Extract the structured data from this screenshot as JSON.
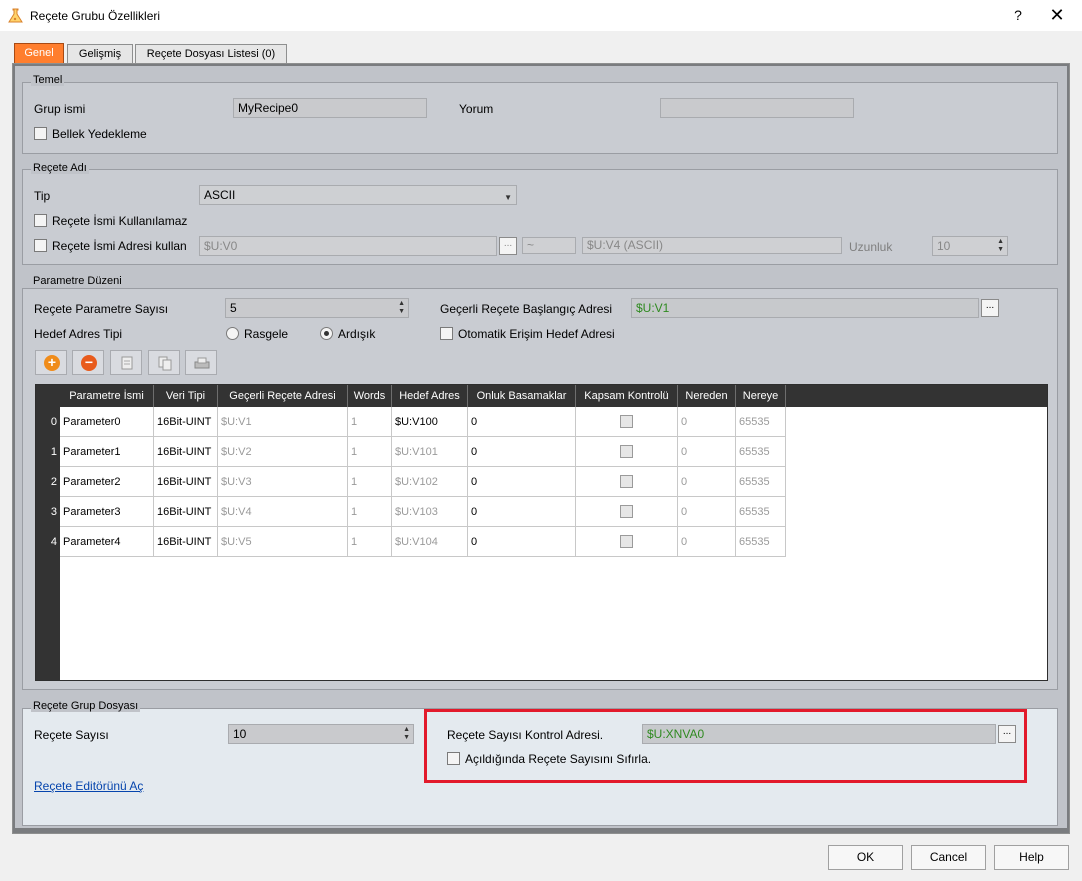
{
  "window": {
    "title": "Reçete Grubu Özellikleri",
    "help_glyph": "?",
    "close_glyph": "✕"
  },
  "tabs": [
    {
      "label": "Genel",
      "active": true
    },
    {
      "label": "Gelişmiş",
      "active": false
    },
    {
      "label": "Reçete Dosyası Listesi (0)",
      "active": false
    }
  ],
  "temel": {
    "title": "Temel",
    "grup_ismi_label": "Grup ismi",
    "grup_ismi_value": "MyRecipe0",
    "yorum_label": "Yorum",
    "yorum_value": "",
    "bellek_label": "Bellek Yedekleme",
    "bellek_checked": false
  },
  "recete_adi": {
    "title": "Reçete Adı",
    "tip_label": "Tip",
    "tip_value": "ASCII",
    "kullanilamaz_label": "Reçete İsmi Kullanılamaz",
    "adresi_label": "Reçete İsmi Adresi kullan",
    "adres_from": "$U:V0",
    "dots": "...",
    "tilde": "~",
    "adres_to": "$U:V4 (ASCII)",
    "uzunluk_label": "Uzunluk",
    "uzunluk_value": "10"
  },
  "parametre": {
    "title": "Parametre Düzeni",
    "sayisi_label": "Reçete Parametre Sayısı",
    "sayisi_value": "5",
    "baslangic_label": "Geçerli Reçete Başlangıç Adresi",
    "baslangic_value": "$U:V1",
    "dots": "...",
    "hedef_tipi_label": "Hedef Adres Tipi",
    "rasgele_label": "Rasgele",
    "ardisik_label": "Ardışık",
    "selected": "Ardışık",
    "otomatik_label": "Otomatik Erişim Hedef Adresi",
    "toolbar": {
      "add": "+",
      "remove": "−"
    }
  },
  "grid": {
    "columns": [
      "Parametre İsmi",
      "Veri Tipi",
      "Geçerli Reçete Adresi",
      "Words",
      "Hedef Adres",
      "Onluk Basamaklar",
      "Kapsam Kontrolü",
      "Nereden",
      "Nereye"
    ],
    "rows": [
      {
        "n": "0",
        "name": "Parameter0",
        "type": "16Bit-UINT",
        "addr": "$U:V1",
        "words": "1",
        "hedef": "$U:V100",
        "onluk": "0",
        "nereden": "0",
        "nereye": "65535"
      },
      {
        "n": "1",
        "name": "Parameter1",
        "type": "16Bit-UINT",
        "addr": "$U:V2",
        "words": "1",
        "hedef": "$U:V101",
        "onluk": "0",
        "nereden": "0",
        "nereye": "65535"
      },
      {
        "n": "2",
        "name": "Parameter2",
        "type": "16Bit-UINT",
        "addr": "$U:V3",
        "words": "1",
        "hedef": "$U:V102",
        "onluk": "0",
        "nereden": "0",
        "nereye": "65535"
      },
      {
        "n": "3",
        "name": "Parameter3",
        "type": "16Bit-UINT",
        "addr": "$U:V4",
        "words": "1",
        "hedef": "$U:V103",
        "onluk": "0",
        "nereden": "0",
        "nereye": "65535"
      },
      {
        "n": "4",
        "name": "Parameter4",
        "type": "16Bit-UINT",
        "addr": "$U:V5",
        "words": "1",
        "hedef": "$U:V104",
        "onluk": "0",
        "nereden": "0",
        "nereye": "65535"
      }
    ]
  },
  "grup_dosyasi": {
    "title": "Reçete Grup Dosyası",
    "sayisi_label": "Reçete Sayısı",
    "sayisi_value": "10",
    "kontrol_label": "Reçete Sayısı Kontrol Adresi.",
    "kontrol_value": "$U:XNVA0",
    "dots": "...",
    "sifirla_label": "Açıldığında Reçete Sayısını Sıfırla.",
    "editor_link": "Reçete Editörünü Aç"
  },
  "buttons": {
    "ok": "OK",
    "cancel": "Cancel",
    "help": "Help"
  },
  "colors": {
    "active_tab": "#ff7e2e",
    "highlight_box": "#e21a2b",
    "green_text": "#2f8a20",
    "grid_header": "#333333"
  }
}
